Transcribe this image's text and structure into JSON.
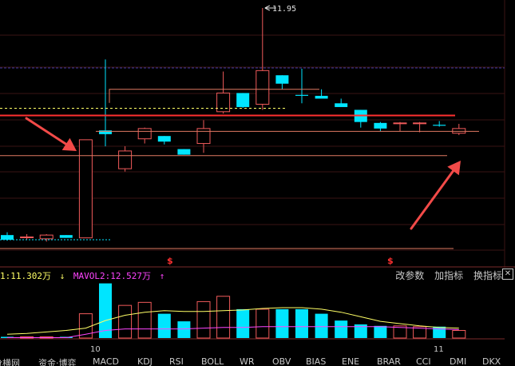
{
  "colors": {
    "up": "#f05a5a",
    "down": "#00e5ff",
    "support_line": "#ff3030",
    "level_line": "#e07a62",
    "ma_yellow": "#ffff66",
    "ma_magenta": "#ff44ff",
    "annotation_arrow": "#f24a48",
    "grid": "#3a1313"
  },
  "price_chart": {
    "high_marker": "11.95",
    "signal_glyph": "$"
  },
  "volume_legend": {
    "mavol1": "1:11.302万",
    "mavol1_arrow": "↓",
    "mavol2": "MAVOL2:12.527万",
    "mavol2_arrow": "↑"
  },
  "toolbar": {
    "change_params": "改参数",
    "add_indicator": "加指标",
    "swap_indicator": "换指标",
    "close": "✕"
  },
  "axis": {
    "month_10": "10",
    "month_11": "11"
  },
  "indicator_tabs": [
    "分横网",
    "资金·博弈",
    "MACD",
    "KDJ",
    "RSI",
    "BOLL",
    "WR",
    "OBV",
    "BIAS",
    "ENE",
    "BRAR",
    "CCI",
    "DMI",
    "DKX"
  ],
  "candles": [
    {
      "o": 9.52,
      "h": 9.55,
      "l": 9.46,
      "c": 9.47
    },
    {
      "o": 9.5,
      "h": 9.53,
      "l": 9.47,
      "c": 9.5
    },
    {
      "o": 9.48,
      "h": 9.53,
      "l": 9.45,
      "c": 9.52
    },
    {
      "o": 9.52,
      "h": 9.52,
      "l": 9.49,
      "c": 9.49
    },
    {
      "o": 9.49,
      "h": 10.54,
      "l": 9.49,
      "c": 10.54
    },
    {
      "o": 10.64,
      "h": 11.4,
      "l": 10.47,
      "c": 10.6
    },
    {
      "o": 10.23,
      "h": 10.47,
      "l": 10.2,
      "c": 10.42
    },
    {
      "o": 10.55,
      "h": 10.67,
      "l": 10.5,
      "c": 10.66
    },
    {
      "o": 10.58,
      "h": 10.58,
      "l": 10.49,
      "c": 10.52
    },
    {
      "o": 10.44,
      "h": 10.44,
      "l": 10.38,
      "c": 10.38
    },
    {
      "o": 10.5,
      "h": 10.75,
      "l": 10.4,
      "c": 10.66
    },
    {
      "o": 10.84,
      "h": 11.27,
      "l": 10.82,
      "c": 11.04
    },
    {
      "o": 11.04,
      "h": 11.04,
      "l": 10.88,
      "c": 10.89
    },
    {
      "o": 10.92,
      "h": 11.95,
      "l": 10.86,
      "c": 11.28
    },
    {
      "o": 11.23,
      "h": 11.23,
      "l": 11.08,
      "c": 11.14
    },
    {
      "o": 11.02,
      "h": 11.3,
      "l": 10.93,
      "c": 11.01
    },
    {
      "o": 11.01,
      "h": 11.08,
      "l": 10.99,
      "c": 10.98
    },
    {
      "o": 10.93,
      "h": 10.98,
      "l": 10.9,
      "c": 10.89
    },
    {
      "o": 10.86,
      "h": 10.86,
      "l": 10.67,
      "c": 10.73
    },
    {
      "o": 10.72,
      "h": 10.73,
      "l": 10.63,
      "c": 10.66
    },
    {
      "o": 10.72,
      "h": 10.73,
      "l": 10.63,
      "c": 10.72
    },
    {
      "o": 10.72,
      "h": 10.73,
      "l": 10.62,
      "c": 10.72
    },
    {
      "o": 10.7,
      "h": 10.74,
      "l": 10.68,
      "c": 10.69
    },
    {
      "o": 10.61,
      "h": 10.71,
      "l": 10.59,
      "c": 10.66
    }
  ],
  "volumes": [
    0.05,
    0.05,
    0.05,
    0.05,
    3.2,
    7.2,
    4.3,
    4.7,
    3.2,
    2.2,
    4.8,
    5.5,
    3.8,
    3.8,
    3.8,
    3.8,
    3.2,
    2.3,
    1.8,
    1.6,
    1.6,
    1.5,
    1.5,
    1.0
  ],
  "ma_yellow": [
    0.5,
    0.6,
    0.8,
    1.0,
    1.3,
    2.3,
    3.0,
    3.4,
    3.6,
    3.5,
    3.5,
    3.6,
    3.7,
    3.9,
    4.0,
    4.0,
    3.8,
    3.4,
    2.8,
    2.2,
    1.9,
    1.6,
    1.4,
    1.3
  ],
  "ma_magenta": [
    0.05,
    0.05,
    0.05,
    0.05,
    0.5,
    1.0,
    1.2,
    1.2,
    1.2,
    1.2,
    1.3,
    1.4,
    1.4,
    1.5,
    1.5,
    1.5,
    1.5,
    1.5,
    1.5,
    1.5,
    1.4,
    1.3,
    1.2,
    1.1
  ],
  "levels": {
    "support": 10.8,
    "upper_box": 11.08,
    "mid_level": 10.63,
    "lower_level": 10.37
  }
}
